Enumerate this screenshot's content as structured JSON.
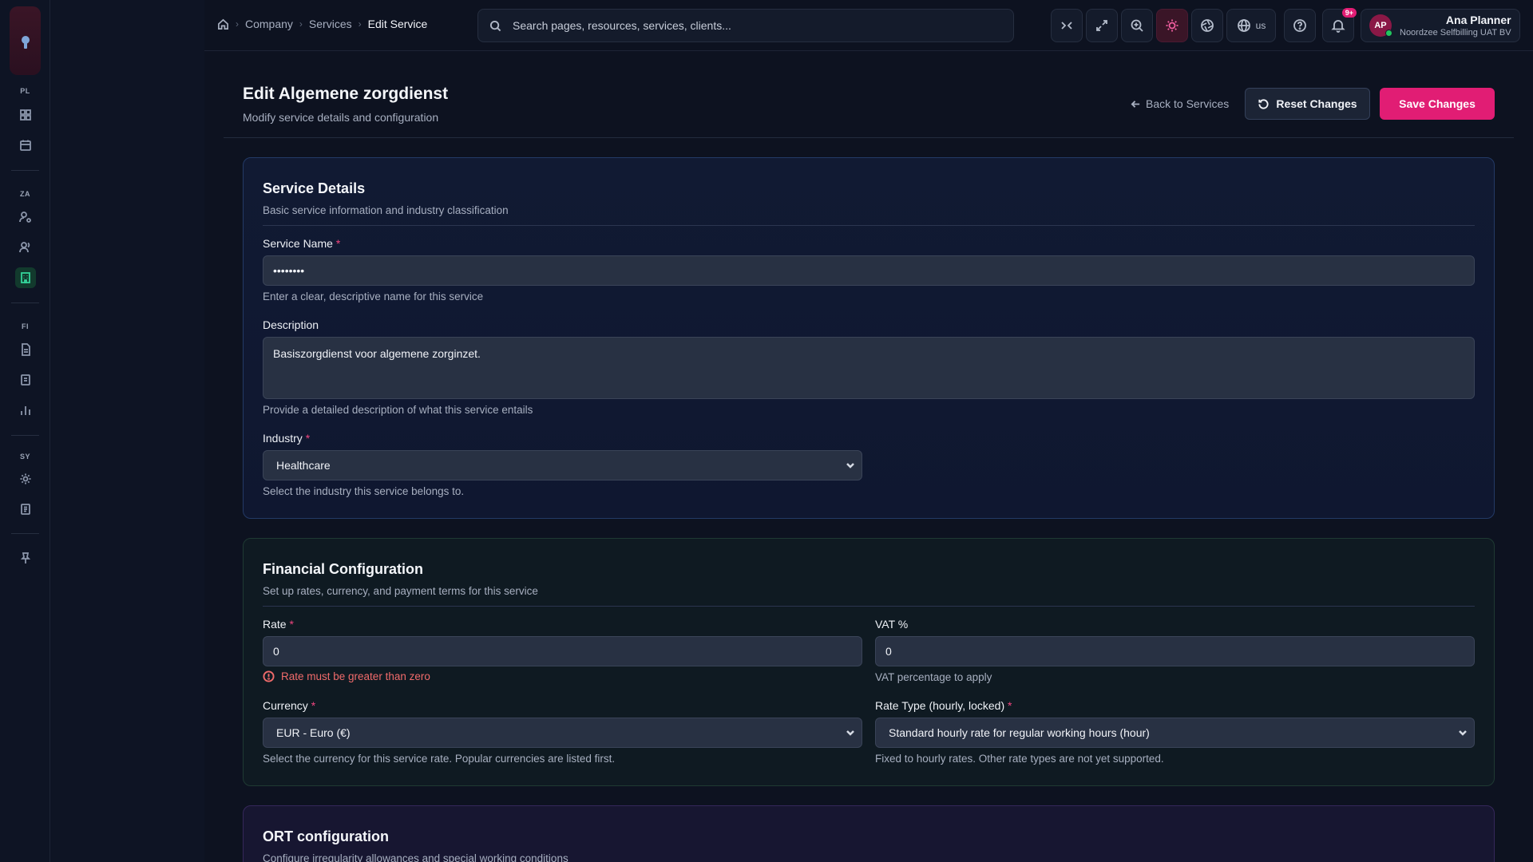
{
  "breadcrumb": {
    "items": [
      "Company",
      "Services"
    ],
    "current": "Edit Service"
  },
  "search": {
    "placeholder": "Search pages, resources, services, clients..."
  },
  "toolbar": {
    "lang_label": "us",
    "notifications_badge": "9+"
  },
  "user": {
    "initials": "AP",
    "name": "Ana Planner",
    "org": "Noordzee Selfbilling UAT BV"
  },
  "sidebar": {
    "sections": [
      "PL",
      "ZA",
      "FI",
      "SY"
    ]
  },
  "page": {
    "title": "Edit Algemene zorgdienst",
    "subtitle": "Modify service details and configuration",
    "back_label": "Back to Services",
    "reset_label": "Reset Changes",
    "save_label": "Save Changes"
  },
  "service_details": {
    "title": "Service Details",
    "subtitle": "Basic service information and industry classification",
    "name_label": "Service Name",
    "name_value": "••••••••",
    "name_help": "Enter a clear, descriptive name for this service",
    "description_label": "Description",
    "description_value": "Basiszorgdienst voor algemene zorginzet.",
    "description_help": "Provide a detailed description of what this service entails",
    "industry_label": "Industry",
    "industry_value": "Healthcare",
    "industry_help": "Select the industry this service belongs to."
  },
  "financial": {
    "title": "Financial Configuration",
    "subtitle": "Set up rates, currency, and payment terms for this service",
    "rate_label": "Rate",
    "rate_value": "0",
    "rate_error": "Rate must be greater than zero",
    "vat_label": "VAT %",
    "vat_value": "0",
    "vat_help": "VAT percentage to apply",
    "currency_label": "Currency",
    "currency_value": "EUR - Euro (€)",
    "currency_help": "Select the currency for this service rate. Popular currencies are listed first.",
    "rate_type_label": "Rate Type (hourly, locked)",
    "rate_type_value": "Standard hourly rate for regular working hours (hour)",
    "rate_type_help": "Fixed to hourly rates. Other rate types are not yet supported."
  },
  "ort": {
    "title": "ORT configuration",
    "subtitle": "Configure irregularity allowances and special working conditions"
  },
  "colors": {
    "accent": "#e11d74",
    "error": "#f06b6b",
    "active_nav": "#34d399"
  }
}
